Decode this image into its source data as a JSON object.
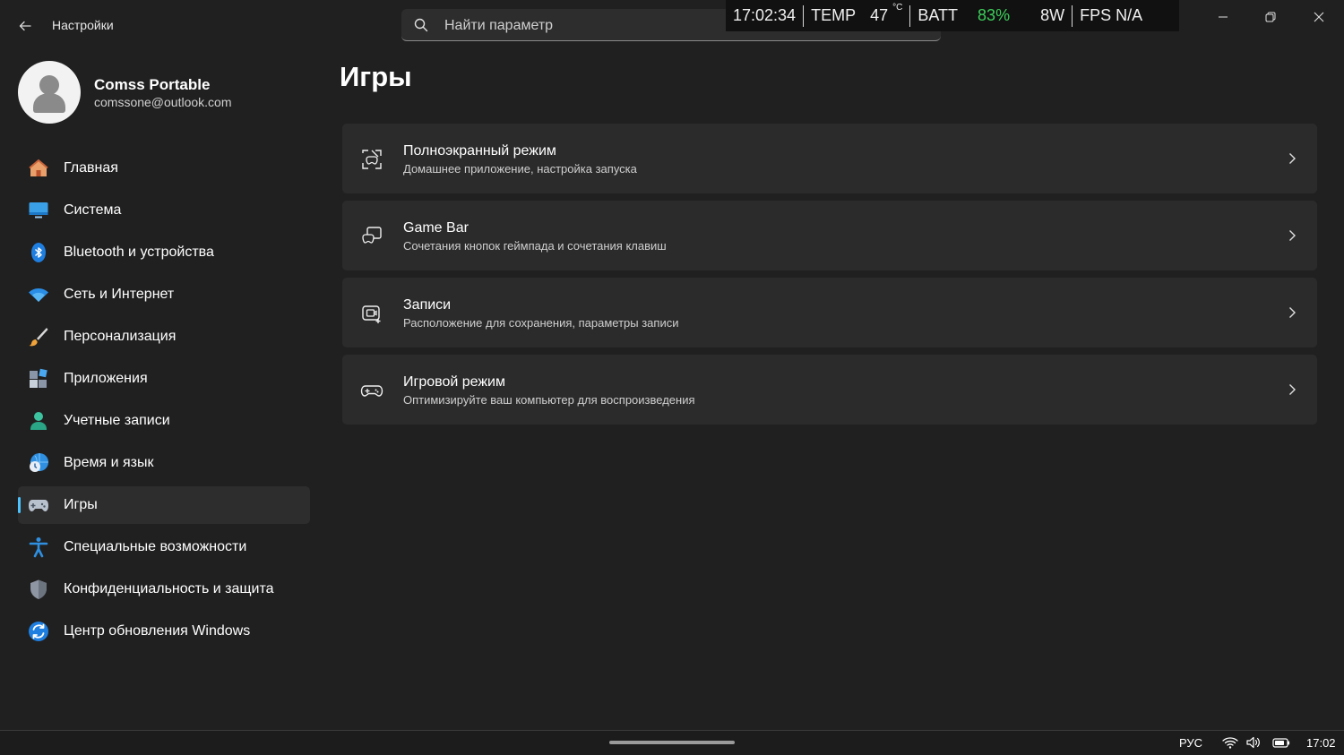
{
  "window": {
    "app_title": "Настройки",
    "icons": {
      "back": "back-arrow-icon",
      "minimize": "minimize-icon",
      "restore": "restore-icon",
      "close": "close-icon"
    }
  },
  "search": {
    "placeholder": "Найти параметр",
    "icon": "search-icon"
  },
  "overlay": {
    "time": "17:02:34",
    "temp_label": "TEMP",
    "temp_value": "47",
    "temp_unit": "°C",
    "batt_label": "BATT",
    "batt_value": "83%",
    "power": "8W",
    "fps": "FPS N/A",
    "colors": {
      "battery": "#3ccf5a"
    }
  },
  "profile": {
    "name": "Comss Portable",
    "email": "comssone@outlook.com"
  },
  "sidebar": {
    "items": [
      {
        "label": "Главная",
        "icon": "home-icon"
      },
      {
        "label": "Система",
        "icon": "monitor-icon"
      },
      {
        "label": "Bluetooth и устройства",
        "icon": "bluetooth-icon"
      },
      {
        "label": "Сеть и Интернет",
        "icon": "wifi-icon"
      },
      {
        "label": "Персонализация",
        "icon": "brush-icon"
      },
      {
        "label": "Приложения",
        "icon": "apps-icon"
      },
      {
        "label": "Учетные записи",
        "icon": "user-icon"
      },
      {
        "label": "Время и язык",
        "icon": "globe-clock-icon"
      },
      {
        "label": "Игры",
        "icon": "gamepad-icon",
        "active": true
      },
      {
        "label": "Специальные возможности",
        "icon": "accessibility-icon"
      },
      {
        "label": "Конфиденциальность и защита",
        "icon": "shield-icon"
      },
      {
        "label": "Центр обновления Windows",
        "icon": "update-icon"
      }
    ],
    "active_accent": "#4cc2ff"
  },
  "main": {
    "title": "Игры",
    "cards": [
      {
        "title": "Полноэкранный режим",
        "subtitle": "Домашнее приложение, настройка запуска",
        "icon": "fullscreen-icon"
      },
      {
        "title": "Game Bar",
        "subtitle": "Сочетания кнопок геймпада и сочетания клавиш",
        "icon": "game-bar-icon"
      },
      {
        "title": "Записи",
        "subtitle": "Расположение для сохранения, параметры записи",
        "icon": "capture-icon"
      },
      {
        "title": "Игровой режим",
        "subtitle": "Оптимизируйте ваш компьютер для воспроизведения",
        "icon": "game-mode-icon"
      }
    ]
  },
  "taskbar": {
    "language": "РУС",
    "time": "17:02",
    "icons": [
      "wifi-icon",
      "volume-icon",
      "battery-icon"
    ]
  }
}
